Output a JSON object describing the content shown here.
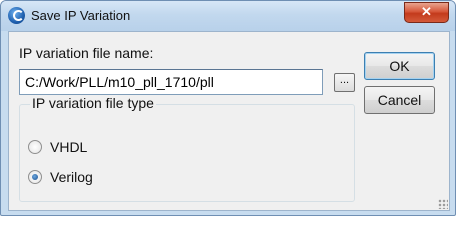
{
  "window": {
    "title": "Save IP Variation",
    "close_label": "✕"
  },
  "file_name": {
    "label": "IP variation file name:",
    "value": "C:/Work/PLL/m10_pll_1710/pll",
    "browse_label": "..."
  },
  "buttons": {
    "ok": "OK",
    "cancel": "Cancel"
  },
  "file_type": {
    "legend": "IP variation file type",
    "options": [
      {
        "label": "VHDL",
        "checked": false
      },
      {
        "label": "Verilog",
        "checked": true
      }
    ]
  },
  "colors": {
    "accent": "#3c7fb1",
    "close_button": "#c33a1c"
  }
}
